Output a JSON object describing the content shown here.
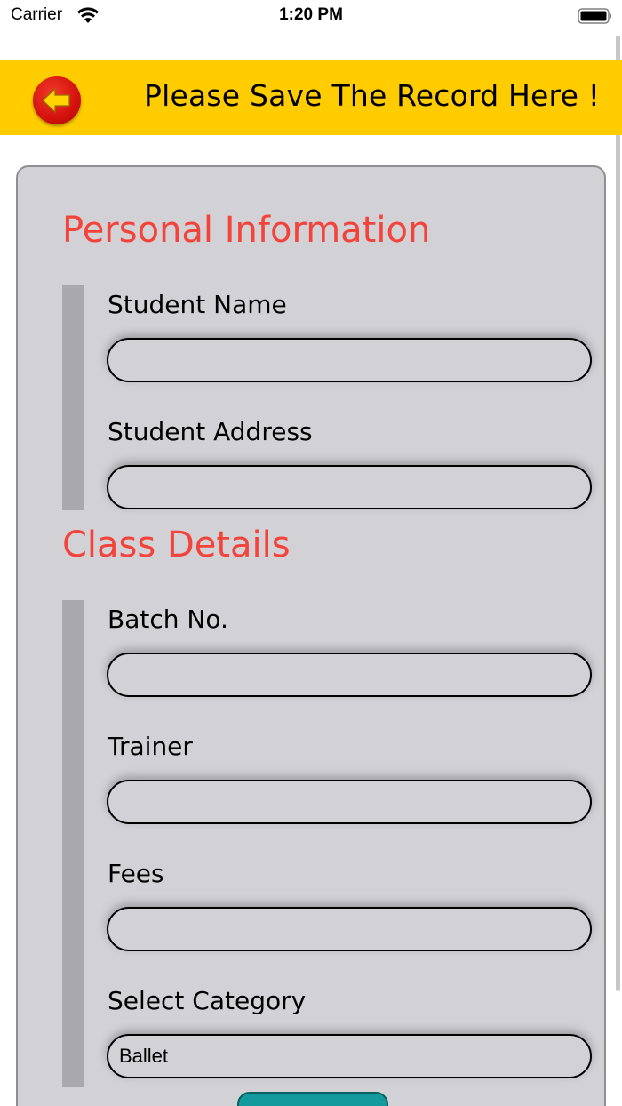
{
  "status_bar": {
    "carrier": "Carrier",
    "time": "1:20 PM",
    "wifi_icon": "wifi-icon",
    "battery_icon": "battery-icon"
  },
  "header": {
    "title": "Please Save The Record Here !",
    "back_icon": "back-arrow-icon",
    "background_color": "#ffcc00"
  },
  "sections": {
    "personal": {
      "title": "Personal Information",
      "student_name_label": "Student Name",
      "student_name_value": "",
      "student_address_label": "Student Address",
      "student_address_value": ""
    },
    "class": {
      "title": "Class Details",
      "batch_label": "Batch No.",
      "batch_value": "",
      "trainer_label": "Trainer",
      "trainer_value": "",
      "fees_label": "Fees",
      "fees_value": "",
      "category_label": "Select Category",
      "category_value": "Ballet"
    }
  },
  "colors": {
    "section_title": "#f4433a",
    "card_background": "#d1d1d6",
    "save_button": "#139a9c"
  }
}
